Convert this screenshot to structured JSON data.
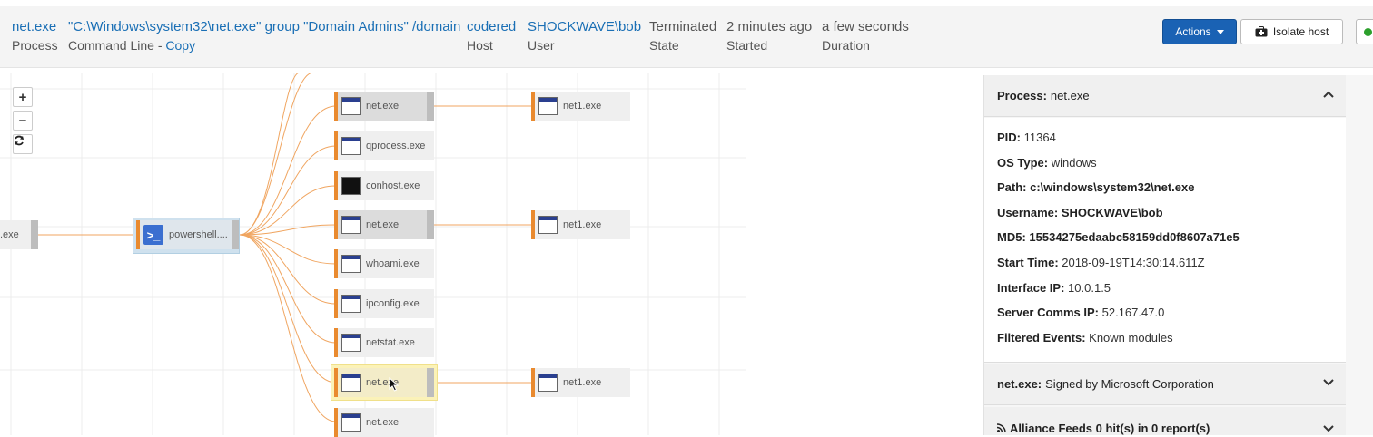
{
  "header": {
    "process": {
      "value": "net.exe",
      "label": "Process"
    },
    "command_line": {
      "value": "\"C:\\Windows\\system32\\net.exe\" group \"Domain Admins\" /domain",
      "label": "Command Line - ",
      "copy": "Copy"
    },
    "host": {
      "value": "codered",
      "label": "Host"
    },
    "user": {
      "value": "SHOCKWAVE\\bob",
      "label": "User"
    },
    "state": {
      "value": "Terminated",
      "label": "State"
    },
    "started": {
      "value": "2 minutes ago",
      "label": "Started"
    },
    "duration": {
      "value": "a few seconds",
      "label": "Duration"
    },
    "actions_label": "Actions",
    "isolate_label": "Isolate host"
  },
  "graph": {
    "zoom_in": "+",
    "zoom_out": "−",
    "parent_node": ".exe",
    "powershell_node": "powershell....",
    "children": [
      "net.exe",
      "qprocess.exe",
      "conhost.exe",
      "net.exe",
      "whoami.exe",
      "ipconfig.exe",
      "netstat.exe",
      "net.exe",
      "net.exe"
    ],
    "grandchildren": [
      "net1.exe",
      "net1.exe",
      "net1.exe"
    ]
  },
  "panel": {
    "process_header": {
      "key": "Process:",
      "value": "net.exe"
    },
    "details": [
      {
        "key": "PID:",
        "value": "11364"
      },
      {
        "key": "OS Type:",
        "value": "windows"
      },
      {
        "key": "Path:",
        "value": "c:\\windows\\system32\\net.exe"
      },
      {
        "key": "Username:",
        "value": "SHOCKWAVE\\bob"
      },
      {
        "key": "MD5:",
        "value": "15534275edaabc58159dd0f8607a71e5"
      },
      {
        "key": "Start Time:",
        "value": "2018-09-19T14:30:14.611Z"
      },
      {
        "key": "Interface IP:",
        "value": "10.0.1.5"
      },
      {
        "key": "Server Comms IP:",
        "value": "52.167.47.0"
      },
      {
        "key": "Filtered Events:",
        "value": "Known modules"
      }
    ],
    "signed": {
      "key": "net.exe:",
      "value": "Signed by Microsoft Corporation"
    },
    "feeds": "Alliance Feeds 0 hit(s) in 0 report(s)"
  },
  "colors": {
    "accent": "#1a62b4",
    "edge": "#e98a2f",
    "link": "#1a6fb5"
  }
}
